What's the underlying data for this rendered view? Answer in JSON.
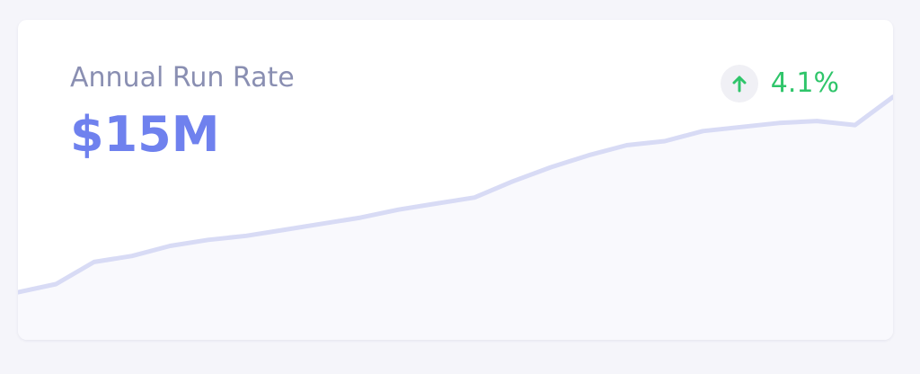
{
  "card": {
    "title": "Annual Run Rate",
    "value": "$15M",
    "trend": {
      "direction": "up",
      "icon": "arrow-up-icon",
      "percent": "4.1%",
      "color": "#2fc56a"
    }
  },
  "chart_data": {
    "type": "area",
    "x": [
      0,
      1,
      2,
      3,
      4,
      5,
      6,
      7,
      8,
      9,
      10,
      11,
      12,
      13,
      14,
      15,
      16,
      17,
      18,
      19,
      20,
      21,
      22,
      23
    ],
    "values": [
      0.0,
      0.8,
      3.0,
      3.6,
      4.6,
      5.2,
      5.6,
      6.2,
      6.8,
      7.4,
      8.2,
      8.8,
      9.4,
      11.0,
      12.4,
      13.6,
      14.6,
      15.0,
      16.0,
      16.4,
      16.8,
      17.0,
      16.6,
      19.4
    ],
    "ylim": [
      0,
      30
    ],
    "grid": false,
    "line_color": "#d8dbf5",
    "fill_color": "#f9f9fd"
  }
}
